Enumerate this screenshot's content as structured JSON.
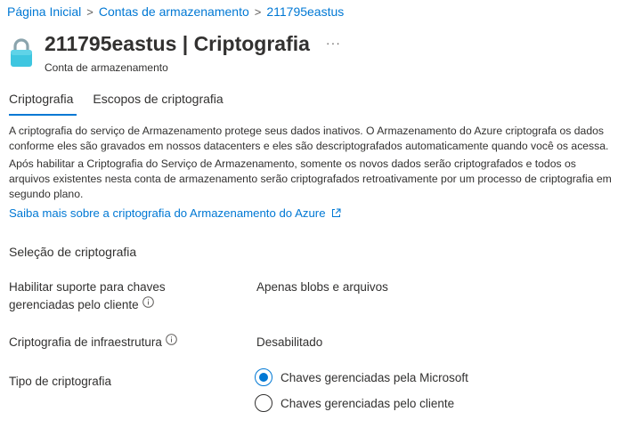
{
  "breadcrumb": {
    "items": [
      "Página Inicial",
      "Contas de armazenamento",
      "211795eastus"
    ]
  },
  "header": {
    "title_bold": "211795eastus",
    "title_rest": " | Criptografia",
    "more": "···",
    "subtitle": "Conta de armazenamento",
    "icon": "lock-icon",
    "icon_color": "#3ec6e0"
  },
  "tabs": [
    {
      "label": "Criptografia",
      "active": true
    },
    {
      "label": "Escopos de criptografia",
      "active": false
    }
  ],
  "description": {
    "p1": "A criptografia do serviço de Armazenamento protege seus dados inativos. O Armazenamento do Azure criptografa os dados conforme eles são gravados em nossos datacenters e eles são descriptografados automaticamente quando você os acessa.",
    "p2": "Após habilitar a Criptografia do Serviço de Armazenamento, somente os novos dados serão criptografados e todos os arquivos existentes nesta conta de armazenamento serão criptografados retroativamente por um processo de criptografia em segundo plano.",
    "link": "Saiba mais sobre a criptografia do Armazenamento do Azure",
    "link_icon": "external-link-icon"
  },
  "section": {
    "title": "Seleção de criptografia"
  },
  "fields": {
    "cmk_support": {
      "label_line1": "Habilitar suporte para chaves",
      "label_line2": "gerenciadas pelo cliente",
      "value": "Apenas blobs e arquivos"
    },
    "infrastructure": {
      "label": "Criptografia de infraestrutura",
      "value": "Desabilitado"
    },
    "encryption_type": {
      "label": "Tipo de criptografia",
      "options": [
        {
          "label": "Chaves gerenciadas pela Microsoft",
          "selected": true
        },
        {
          "label": "Chaves gerenciadas pelo cliente",
          "selected": false
        }
      ]
    }
  },
  "colors": {
    "accent": "#0078d4",
    "text": "#323130"
  }
}
